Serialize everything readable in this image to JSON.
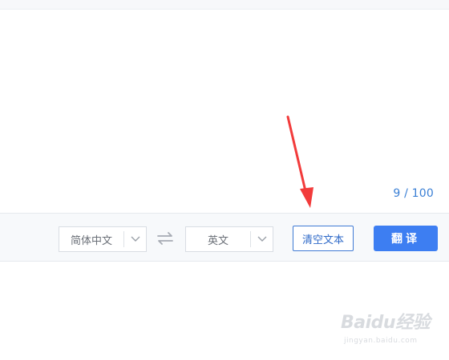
{
  "input": {
    "char_count": "9 / 100"
  },
  "toolbar": {
    "source_language": "简体中文",
    "target_language": "英文",
    "clear_label": "清空文本",
    "translate_label": "翻译"
  },
  "colors": {
    "accent": "#3d7ef2",
    "counter": "#3a7fd5",
    "annotation_arrow": "#f23b3b"
  },
  "watermark": {
    "logo": "Baidu经验",
    "url": "jingyan.baidu.com"
  }
}
